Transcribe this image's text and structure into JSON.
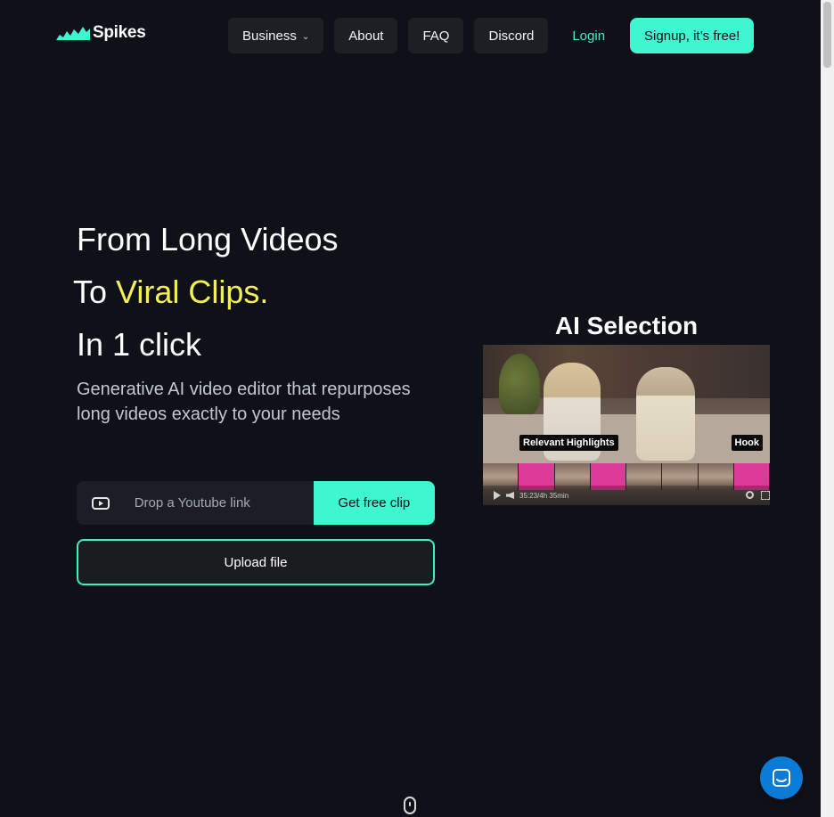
{
  "brand": {
    "name": "Spikes"
  },
  "nav": {
    "items": [
      {
        "label": "Business",
        "has_dropdown": true
      },
      {
        "label": "About"
      },
      {
        "label": "FAQ"
      },
      {
        "label": "Discord"
      }
    ],
    "login": "Login",
    "signup": "Signup, it’s free!"
  },
  "hero": {
    "line1": "From Long Videos",
    "line2_prefix": "To ",
    "line2_highlight": "Viral Clips.",
    "line3": "In 1 click",
    "subtitle": "Generative AI video editor that repurposes long videos exactly to your needs",
    "link_placeholder": "Drop a Youtube link",
    "get_clip": "Get free clip",
    "upload": "Upload file"
  },
  "preview": {
    "title": "AI Selection",
    "tag_left": "Relevant Highlights",
    "tag_right": "Hook",
    "time": "35:23/4h 35min"
  },
  "colors": {
    "accent": "#3ef6cf",
    "highlight_text": "#f5ee55",
    "background": "#0e1117",
    "clip_highlight": "#e2399b",
    "chat_button": "#0b7bd8"
  }
}
